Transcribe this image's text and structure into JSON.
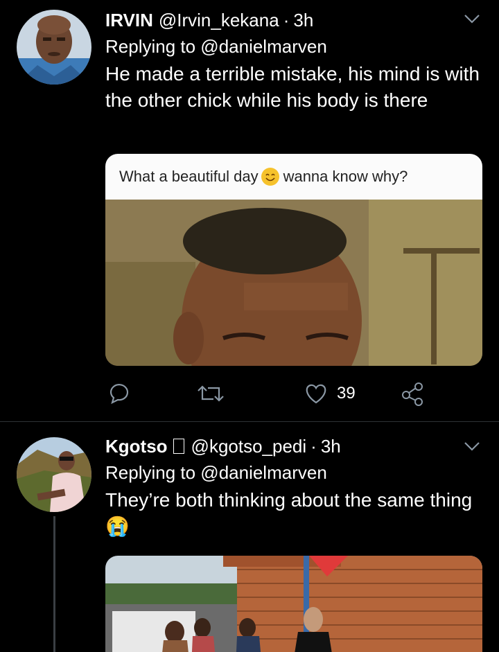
{
  "tweets": [
    {
      "name": "IRVIN",
      "handle": "@Irvin_kekana",
      "sep": "·",
      "time": "3h",
      "reply": "Replying to @danielmarven",
      "text": "He made a terrible mistake, his mind is with the other chick while his body is there",
      "media_caption_a": "What a beautiful day",
      "media_caption_b": "wanna know why?",
      "likes": "39"
    },
    {
      "name": "Kgotso",
      "handle": "@kgotso_pedi",
      "sep": "·",
      "time": "3h",
      "reply": "Replying to @danielmarven",
      "text": "They’re both thinking about the same thing",
      "emoji": "😭"
    }
  ],
  "icons": {
    "reply": "reply-icon",
    "retweet": "retweet-icon",
    "like": "heart-icon",
    "share": "share-icon",
    "menu": "chevron-down-icon"
  },
  "colors": {
    "background": "#000000",
    "divider": "#2f3336",
    "text": "#ffffff"
  }
}
